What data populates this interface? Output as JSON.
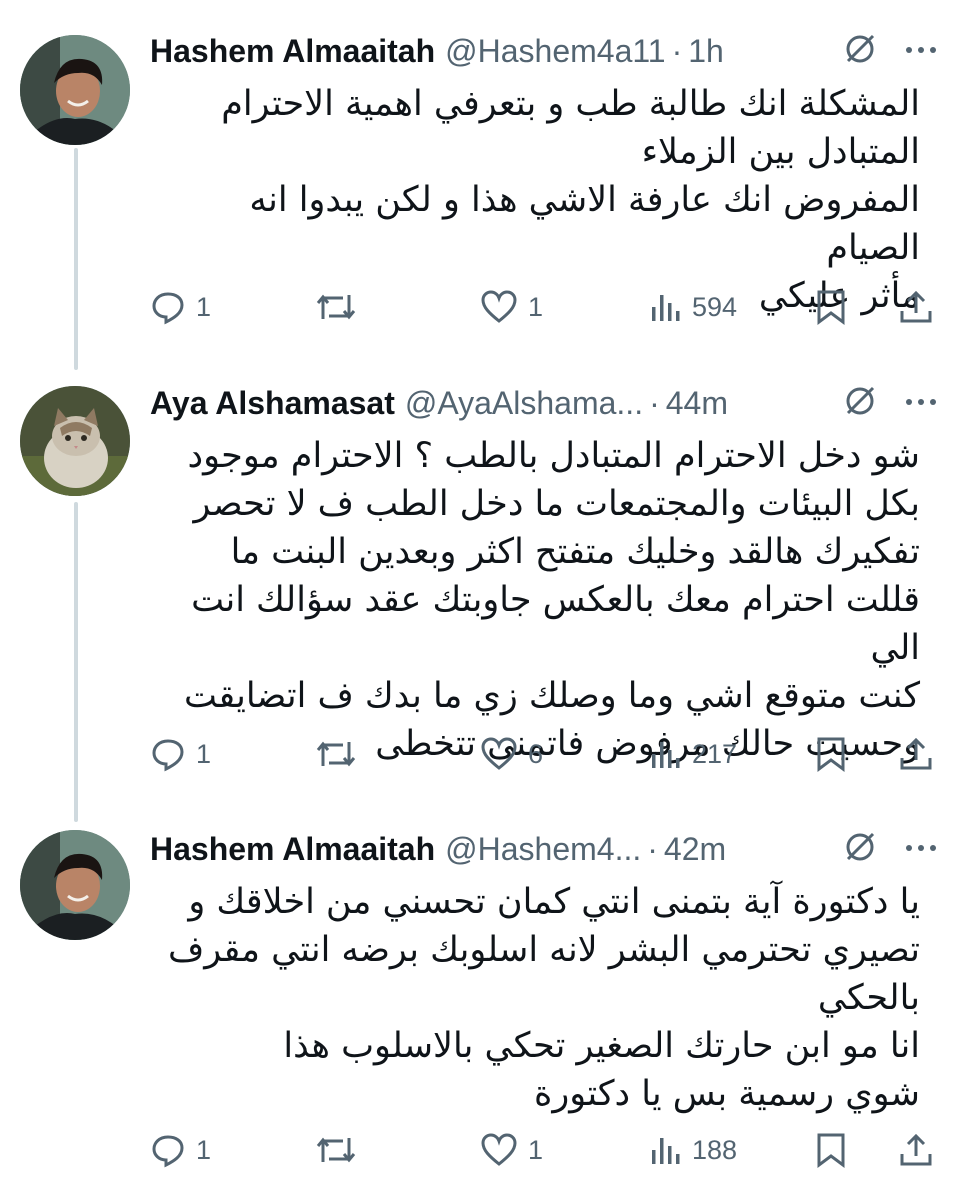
{
  "tweets": [
    {
      "author": "Hashem Almaaitah",
      "handle": "@Hashem4a11",
      "time": "1h",
      "lines": [
        "المشكلة انك طالبة طب و بتعرفي اهمية الاحترام",
        "المتبادل بين الزملاء",
        "المفروض انك عارفة الاشي هذا و لكن يبدوا انه الصيام",
        "مأثر عليكي"
      ],
      "replies": "1",
      "retweets": "",
      "likes": "1",
      "views": "594"
    },
    {
      "author": "Aya Alshamasat",
      "handle": "@AyaAlshama...",
      "time": "44m",
      "lines": [
        "شو دخل الاحترام المتبادل بالطب ؟ الاحترام موجود",
        "بكل البيئات والمجتمعات ما دخل الطب ف لا تحصر",
        "تفكيرك هالقد وخليك متفتح اكثر وبعدين البنت ما",
        "قللت احترام معك بالعكس جاوبتك عقد سؤالك انت الي",
        "كنت متوقع اشي وما وصلك زي ما بدك ف اتضايقت",
        "وحسيت حالك مرفوض فاتمنى تتخطى"
      ],
      "replies": "1",
      "retweets": "",
      "likes": "6",
      "views": "217"
    },
    {
      "author": "Hashem Almaaitah",
      "handle": "@Hashem4...",
      "time": "42m",
      "lines": [
        "يا دكتورة آية بتمنى انتي كمان تحسني من اخلاقك و",
        "تصيري تحترمي البشر لانه اسلوبك برضه انتي مقرف",
        "بالحكي",
        "انا مو ابن حارتك الصغير تحكي بالاسلوب هذا",
        "شوي رسمية بس يا دكتورة"
      ],
      "replies": "1",
      "retweets": "",
      "likes": "1",
      "views": "188"
    }
  ],
  "separator": "·",
  "icons": [
    "reply-icon",
    "retweet-icon",
    "like-icon",
    "views-icon",
    "bookmark-icon",
    "share-icon",
    "grok-icon",
    "more-icon"
  ],
  "colors": {
    "text": "#0f1419",
    "muted": "#536471",
    "thread_line": "#cfd9de"
  }
}
